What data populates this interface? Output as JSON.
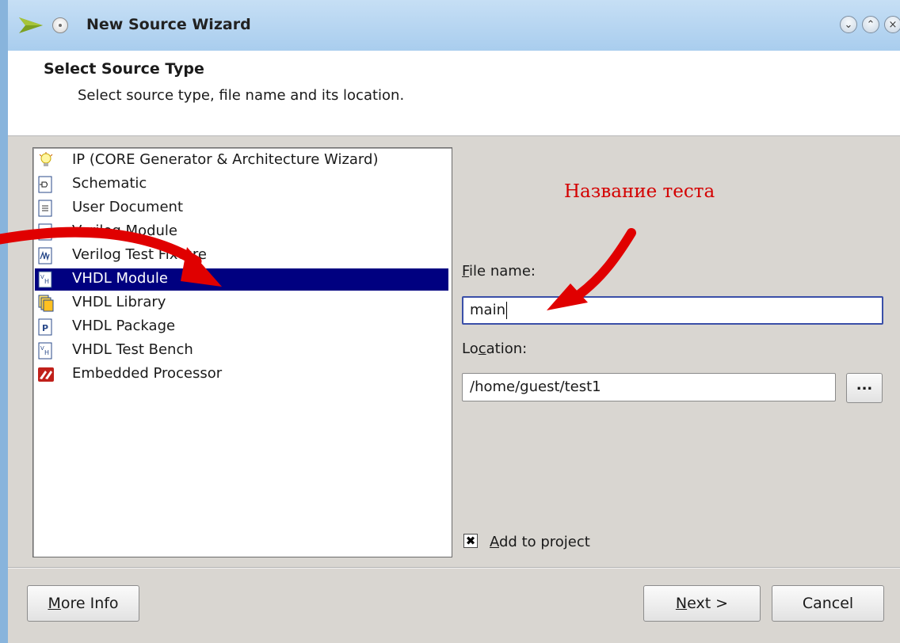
{
  "window": {
    "title": "New Source Wizard",
    "controls": [
      "⌄",
      "⌃",
      "×"
    ]
  },
  "header": {
    "title": "Select Source Type",
    "subtitle": "Select source type, file name and its location."
  },
  "source_types": {
    "selected": "VHDL Module",
    "items": [
      {
        "label": "IP (CORE Generator & Architecture Wizard)",
        "icon": "lightbulb-icon"
      },
      {
        "label": "Schematic",
        "icon": "schematic-icon"
      },
      {
        "label": "User Document",
        "icon": "document-icon"
      },
      {
        "label": "Verilog Module",
        "icon": "verilog-module-icon"
      },
      {
        "label": "Verilog Test Fixture",
        "icon": "verilog-test-fixture-icon"
      },
      {
        "label": "VHDL Module",
        "icon": "vhdl-module-icon"
      },
      {
        "label": "VHDL Library",
        "icon": "vhdl-library-icon"
      },
      {
        "label": "VHDL Package",
        "icon": "vhdl-package-icon"
      },
      {
        "label": "VHDL Test Bench",
        "icon": "vhdl-test-bench-icon"
      },
      {
        "label": "Embedded Processor",
        "icon": "embedded-processor-icon"
      }
    ]
  },
  "form": {
    "file_name": {
      "label_prefix": "",
      "label_mnemonic": "F",
      "label_rest": "ile name:",
      "value": "main"
    },
    "location": {
      "label_prefix": "Lo",
      "label_mnemonic": "c",
      "label_rest": "ation:",
      "value": "/home/guest/test1"
    },
    "browse_label": "...",
    "add_to_project": {
      "checked": true,
      "label_mnemonic": "A",
      "label_rest": "dd to project"
    }
  },
  "footer": {
    "more_info": {
      "mnemonic": "M",
      "rest": "ore Info"
    },
    "next": {
      "mnemonic": "N",
      "rest": "ext >"
    },
    "cancel": "Cancel"
  },
  "annotation": {
    "text": "Название теста",
    "color": "#d40000"
  }
}
